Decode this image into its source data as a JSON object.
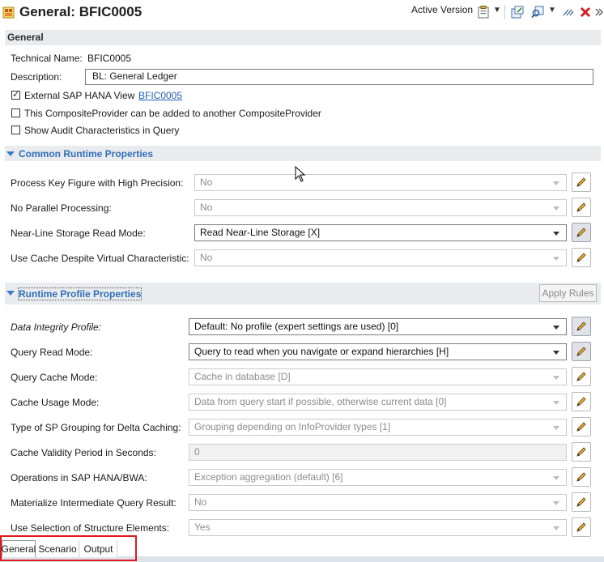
{
  "title": {
    "text": "General: BFIC0005",
    "active_version": "Active Version"
  },
  "toolbar": {
    "icons": [
      "clipboard-icon",
      "chevron-down-icon",
      "export-icon",
      "search-icon",
      "chevron-down-icon",
      "pin-icon",
      "close-icon",
      "more-icon"
    ]
  },
  "general": {
    "section_title": "General",
    "technical_name_label": "Technical Name:",
    "technical_name_value": "BFIC0005",
    "description_label": "Description:",
    "description_value": "BL: General Ledger",
    "external_view_label": "External SAP HANA View",
    "external_view_link": "BFIC0005",
    "external_view_checked": true,
    "composite_label": "This CompositeProvider can be added to another CompositeProvider",
    "composite_checked": false,
    "audit_label": "Show Audit Characteristics in Query",
    "audit_checked": false
  },
  "common_runtime": {
    "section_title": "Common Runtime Properties",
    "rows": [
      {
        "label": "Process Key Figure with High Precision:",
        "value": "No",
        "enabled": false
      },
      {
        "label": "No Parallel Processing:",
        "value": "No",
        "enabled": false
      },
      {
        "label": "Near-Line Storage Read Mode:",
        "value": "Read Near-Line Storage [X]",
        "enabled": true
      },
      {
        "label": "Use Cache Despite Virtual Characteristic:",
        "value": "No",
        "enabled": false
      }
    ]
  },
  "runtime_profile": {
    "section_title": "Runtime Profile Properties",
    "apply_rules": "Apply Rules",
    "rows": [
      {
        "label": "Data Integrity Profile:",
        "value": "Default: No profile (expert settings are used) [0]",
        "enabled": true,
        "italic": true
      },
      {
        "label": "Query Read Mode:",
        "value": "Query to read when you navigate or expand hierarchies [H]",
        "enabled": true
      },
      {
        "label": "Query Cache Mode:",
        "value": "Cache in database [D]",
        "enabled": false
      },
      {
        "label": "Cache Usage Mode:",
        "value": "Data from query start if possible, otherwise current data [0]",
        "enabled": false
      },
      {
        "label": "Type of SP Grouping for Delta Caching:",
        "value": "Grouping depending on InfoProvider types [1]",
        "enabled": false
      },
      {
        "label": "Cache Validity Period in Seconds:",
        "value": "0",
        "enabled": false,
        "readonly_field": true
      },
      {
        "label": "Operations in SAP HANA/BWA:",
        "value": "Exception aggregation (default) [6]",
        "enabled": false
      },
      {
        "label": "Materialize Intermediate Query Result:",
        "value": "No",
        "enabled": false
      },
      {
        "label": "Use Selection of Structure Elements:",
        "value": "Yes",
        "enabled": false
      }
    ]
  },
  "tabs": [
    "General",
    "Scenario",
    "Output"
  ]
}
